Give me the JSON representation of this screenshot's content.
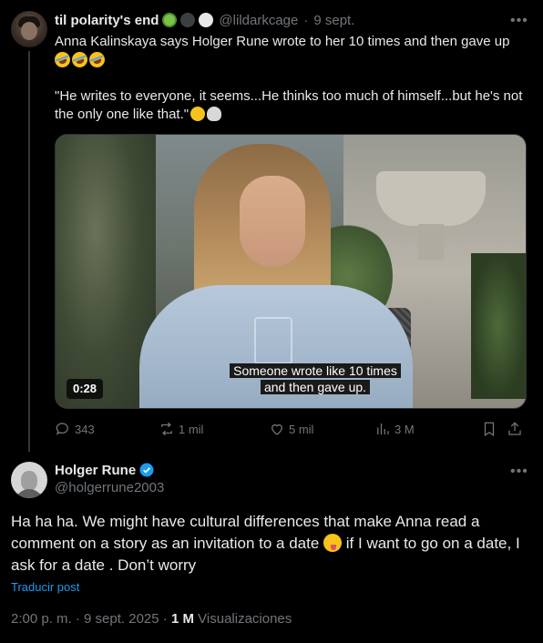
{
  "tweet1": {
    "display_name": "til polarity's end",
    "handle": "@lildarkcage",
    "separator": "·",
    "date": "9 sept.",
    "text_line1": "Anna Kalinskaya says Holger Rune wrote to her 10 times and then gave up",
    "emoji_laugh": "🤣🤣🤣",
    "quote": "\"He writes to everyone, it seems...He thinks too much of himself...but he's not the only one like that.\"",
    "quote_emojis": [
      "joy-emoji",
      "skull-emoji"
    ],
    "video": {
      "caption_line1": "Someone wrote like 10 times",
      "caption_line2": "and then gave up.",
      "duration": "0:28"
    },
    "actions": {
      "replies": "343",
      "reposts": "1 mil",
      "likes": "5 mil",
      "views": "3 M"
    }
  },
  "tweet2": {
    "display_name": "Holger Rune",
    "handle": "@holgerrune2003",
    "verified": true,
    "text_before_emoji": "Ha ha ha. We might have cultural differences that make Anna read a comment on a story as an invitation to a date",
    "text_after_emoji": " if I want to go on a date, I ask for a date . Don’t worry",
    "translate_label": "Traducir post",
    "time": "2:00 p. m.",
    "separator": "·",
    "date": "9 sept. 2025",
    "separator2": "·",
    "views_count": "1 M",
    "views_label": "Visualizaciones"
  },
  "colors": {
    "background": "#000000",
    "text_primary": "#e7e9ea",
    "text_secondary": "#71767b",
    "link": "#1d9bf0",
    "verified": "#1d9bf0"
  },
  "icons": [
    "more-icon",
    "reply-icon",
    "repost-icon",
    "like-icon",
    "views-icon",
    "bookmark-icon",
    "share-icon",
    "verified-icon"
  ]
}
